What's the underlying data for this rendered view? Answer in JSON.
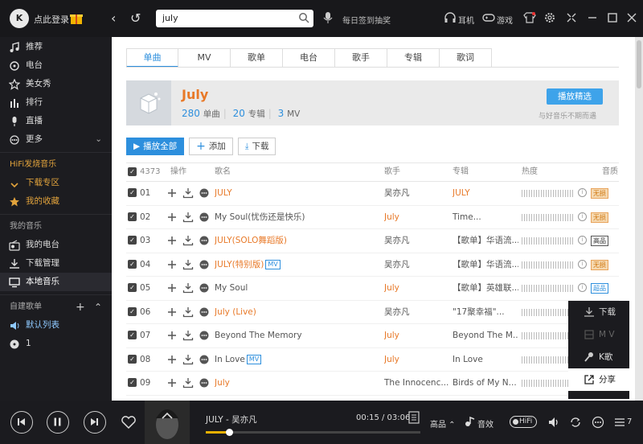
{
  "topbar": {
    "logo": "K",
    "login": "点此登录",
    "search_value": "july",
    "signin": "每日签到抽奖",
    "earphone": "耳机",
    "game": "游戏"
  },
  "sidebar": {
    "main_items": [
      {
        "label": "推荐",
        "icon": "music-note-icon"
      },
      {
        "label": "电台",
        "icon": "radio-icon"
      },
      {
        "label": "美女秀",
        "icon": "star-icon"
      },
      {
        "label": "排行",
        "icon": "bar-chart-icon"
      },
      {
        "label": "直播",
        "icon": "microphone-icon"
      },
      {
        "label": "更多",
        "icon": "more-icon"
      }
    ],
    "hifi_header": "HiFi发烧音乐",
    "download_zone": "下载专区",
    "favorites": "我的收藏",
    "my_music": "我的音乐",
    "my_radio": "我的电台",
    "download_manage": "下载管理",
    "local_music": "本地音乐",
    "playlists_header": "自建歌单",
    "default_list": "默认列表",
    "list_one": "1"
  },
  "tabs": [
    "单曲",
    "MV",
    "歌单",
    "电台",
    "歌手",
    "专辑",
    "歌词"
  ],
  "artist": {
    "name": "July",
    "songs_count": "280",
    "songs_label": "单曲",
    "albums_count": "20",
    "albums_label": "专辑",
    "mv_count": "3",
    "mv_label": "MV",
    "play_pick": "播放精选",
    "pick_sub": "与好音乐不期而遇"
  },
  "actions": {
    "play_all": "播放全部",
    "add": "添加",
    "download": "下载"
  },
  "table": {
    "count": "4373",
    "headers": {
      "ops": "操作",
      "song": "歌名",
      "artist": "歌手",
      "album": "专辑",
      "heat": "热度",
      "quality": "音质"
    },
    "rows": [
      {
        "no": "01",
        "song": "JULY",
        "song_orange": true,
        "mv": "",
        "artist": "吴亦凡",
        "artist_orange": false,
        "album": "JULY",
        "album_orange": true,
        "quality": "无损"
      },
      {
        "no": "02",
        "song": "My Soul(忧伤还是快乐)",
        "song_orange": false,
        "mv": "",
        "artist": "July",
        "artist_orange": true,
        "album": "Time...",
        "album_orange": false,
        "quality": "无损"
      },
      {
        "no": "03",
        "song": "JULY(SOLO舞蹈版)",
        "song_orange": true,
        "mv": "",
        "artist": "吴亦凡",
        "artist_orange": false,
        "album": "【歌单】华语流...",
        "album_orange": false,
        "quality": "高品"
      },
      {
        "no": "04",
        "song": "JULY(特别版)",
        "song_orange": true,
        "mv": "MV",
        "artist": "吴亦凡",
        "artist_orange": false,
        "album": "【歌单】华语流...",
        "album_orange": false,
        "quality": "无损"
      },
      {
        "no": "05",
        "song": "My Soul",
        "song_orange": false,
        "mv": "",
        "artist": "July",
        "artist_orange": true,
        "album": "【歌单】英雄联...",
        "album_orange": false,
        "quality": "超品"
      },
      {
        "no": "06",
        "song": "July (Live)",
        "song_orange": true,
        "mv": "",
        "artist": "吴亦凡",
        "artist_orange": false,
        "album": "\"17聚幸福\"...",
        "album_orange": false,
        "quality": ""
      },
      {
        "no": "07",
        "song": "Beyond The Memory",
        "song_orange": false,
        "mv": "",
        "artist": "July",
        "artist_orange": true,
        "album": "Beyond The M...",
        "album_orange": false,
        "quality": ""
      },
      {
        "no": "08",
        "song": "In Love",
        "song_orange": false,
        "mv": "MV",
        "artist": "July",
        "artist_orange": true,
        "album": "In Love",
        "album_orange": false,
        "quality": ""
      },
      {
        "no": "09",
        "song": "July",
        "song_orange": true,
        "mv": "",
        "artist": "The Innocenc...",
        "artist_orange": false,
        "album": "Birds of My N...",
        "album_orange": false,
        "quality": ""
      }
    ]
  },
  "context_menu": {
    "download": "下载",
    "mv": "M V",
    "ksong": "K歌",
    "share": "分享"
  },
  "player": {
    "now_playing": "JULY - 吴亦凡",
    "time": "00:15 / 03:06",
    "progress": 0.11,
    "quality": "高品",
    "effect": "音效",
    "hifi": "HiFi",
    "playlist_count": "7"
  }
}
